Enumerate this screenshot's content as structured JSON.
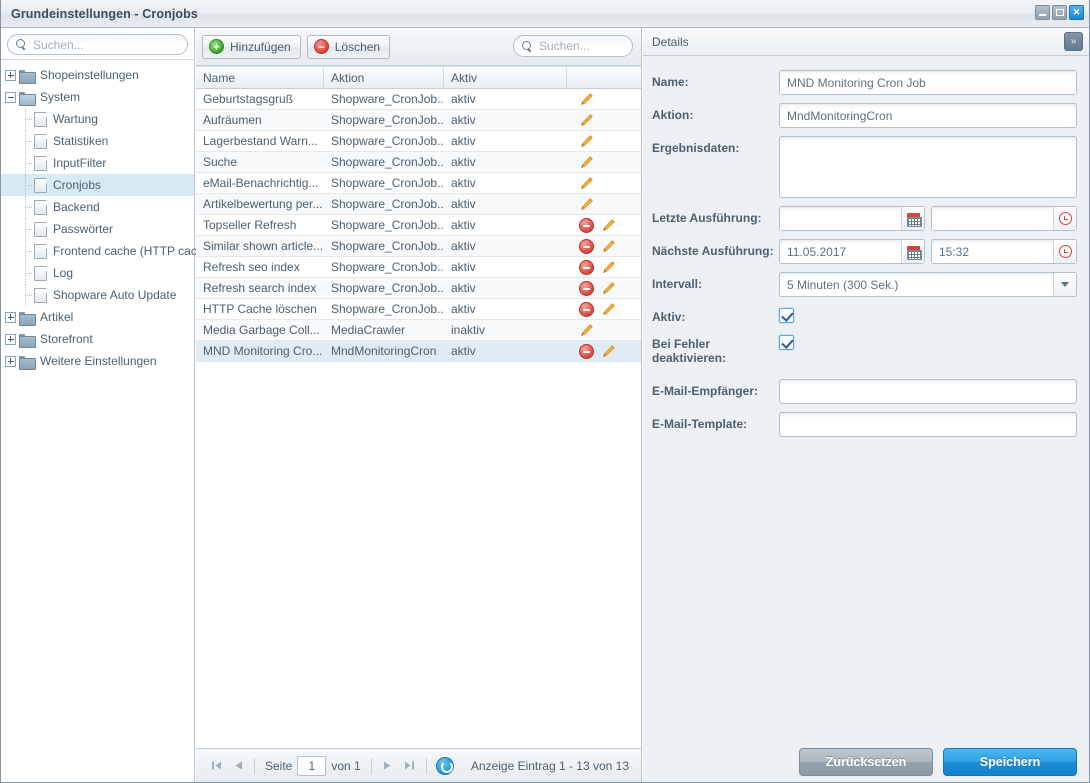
{
  "window": {
    "title": "Grundeinstellungen - Cronjobs",
    "minimize_label": "Minimieren",
    "maximize_label": "Maximieren",
    "close_label": "Schließen"
  },
  "sidebar": {
    "search_placeholder": "Suchen...",
    "search_value": "",
    "items": [
      {
        "label": "Shopeinstellungen",
        "type": "folder",
        "state": "collapsed",
        "depth": 0,
        "selected": false
      },
      {
        "label": "System",
        "type": "folder",
        "state": "expanded",
        "depth": 0,
        "selected": false
      },
      {
        "label": "Wartung",
        "type": "file",
        "state": "leaf",
        "depth": 1,
        "selected": false
      },
      {
        "label": "Statistiken",
        "type": "file",
        "state": "leaf",
        "depth": 1,
        "selected": false
      },
      {
        "label": "InputFilter",
        "type": "file",
        "state": "leaf",
        "depth": 1,
        "selected": false
      },
      {
        "label": "Cronjobs",
        "type": "file",
        "state": "leaf",
        "depth": 1,
        "selected": true
      },
      {
        "label": "Backend",
        "type": "file",
        "state": "leaf",
        "depth": 1,
        "selected": false
      },
      {
        "label": "Passwörter",
        "type": "file",
        "state": "leaf",
        "depth": 1,
        "selected": false
      },
      {
        "label": "Frontend cache (HTTP cache)",
        "type": "file",
        "state": "leaf",
        "depth": 1,
        "selected": false
      },
      {
        "label": "Log",
        "type": "file",
        "state": "leaf",
        "depth": 1,
        "selected": false
      },
      {
        "label": "Shopware Auto Update",
        "type": "file",
        "state": "leaf",
        "depth": 1,
        "selected": false
      },
      {
        "label": "Artikel",
        "type": "folder",
        "state": "collapsed",
        "depth": 0,
        "selected": false
      },
      {
        "label": "Storefront",
        "type": "folder",
        "state": "collapsed",
        "depth": 0,
        "selected": false
      },
      {
        "label": "Weitere Einstellungen",
        "type": "folder",
        "state": "collapsed",
        "depth": 0,
        "selected": false
      }
    ]
  },
  "grid": {
    "toolbar": {
      "add_label": "Hinzufügen",
      "add_icon": "plus-circle-green-icon",
      "delete_label": "Löschen",
      "delete_icon": "minus-circle-red-icon",
      "search_placeholder": "Suchen...",
      "search_value": ""
    },
    "columns": [
      "Name",
      "Aktion",
      "Aktiv",
      ""
    ],
    "rows": [
      {
        "name": "Geburtstagsgruß",
        "aktion": "Shopware_CronJob...",
        "aktiv": "aktiv",
        "has_delete": false,
        "selected": false
      },
      {
        "name": "Aufräumen",
        "aktion": "Shopware_CronJob...",
        "aktiv": "aktiv",
        "has_delete": false,
        "selected": false
      },
      {
        "name": "Lagerbestand Warn...",
        "aktion": "Shopware_CronJob...",
        "aktiv": "aktiv",
        "has_delete": false,
        "selected": false
      },
      {
        "name": "Suche",
        "aktion": "Shopware_CronJob...",
        "aktiv": "aktiv",
        "has_delete": false,
        "selected": false
      },
      {
        "name": "eMail-Benachrichtig...",
        "aktion": "Shopware_CronJob...",
        "aktiv": "aktiv",
        "has_delete": false,
        "selected": false
      },
      {
        "name": "Artikelbewertung per...",
        "aktion": "Shopware_CronJob...",
        "aktiv": "aktiv",
        "has_delete": false,
        "selected": false
      },
      {
        "name": "Topseller Refresh",
        "aktion": "Shopware_CronJob...",
        "aktiv": "aktiv",
        "has_delete": true,
        "selected": false
      },
      {
        "name": "Similar shown article...",
        "aktion": "Shopware_CronJob...",
        "aktiv": "aktiv",
        "has_delete": true,
        "selected": false
      },
      {
        "name": "Refresh seo index",
        "aktion": "Shopware_CronJob...",
        "aktiv": "aktiv",
        "has_delete": true,
        "selected": false
      },
      {
        "name": "Refresh search index",
        "aktion": "Shopware_CronJob...",
        "aktiv": "aktiv",
        "has_delete": true,
        "selected": false
      },
      {
        "name": "HTTP Cache löschen",
        "aktion": "Shopware_CronJob...",
        "aktiv": "aktiv",
        "has_delete": true,
        "selected": false
      },
      {
        "name": "Media Garbage Coll...",
        "aktion": "MediaCrawler",
        "aktiv": "inaktiv",
        "has_delete": false,
        "selected": false
      },
      {
        "name": "MND Monitoring Cro...",
        "aktion": "MndMonitoringCron",
        "aktiv": "aktiv",
        "has_delete": true,
        "selected": true
      }
    ]
  },
  "pagination": {
    "first_icon": "first-page-icon",
    "prev_icon": "previous-page-icon",
    "page_label": "Seite",
    "page_value": "1",
    "of_label": "von 1",
    "next_icon": "next-page-icon",
    "last_icon": "last-page-icon",
    "refresh_icon": "refresh-icon",
    "count_text": "Anzeige Eintrag 1 - 13 von 13"
  },
  "details": {
    "header_title": "Details",
    "collapse_icon": "chevron-double-right-icon",
    "fields": {
      "name_label": "Name:",
      "name_value": "MND Monitoring Cron Job",
      "aktion_label": "Aktion:",
      "aktion_value": "MndMonitoringCron",
      "ergebnisdaten_label": "Ergebnisdaten:",
      "ergebnisdaten_value": "",
      "letzte_label": "Letzte Ausführung:",
      "letzte_date_value": "",
      "letzte_time_value": "",
      "naechste_label": "Nächste Ausführung:",
      "naechste_date_value": "11.05.2017",
      "naechste_time_value": "15:32",
      "intervall_label": "Intervall:",
      "intervall_value": "5 Minuten (300 Sek.)",
      "aktiv_label": "Aktiv:",
      "aktiv_checked": true,
      "bei_fehler_label": "Bei Fehler deaktivieren:",
      "bei_fehler_checked": true,
      "email_empfaenger_label": "E-Mail-Empfänger:",
      "email_empfaenger_value": "",
      "email_template_label": "E-Mail-Template:",
      "email_template_value": ""
    },
    "calendar_icon": "calendar-icon",
    "clock_icon": "clock-icon",
    "dropdown_icon": "chevron-down-icon",
    "footer": {
      "reset_label": "Zurücksetzen",
      "save_label": "Speichern"
    }
  },
  "colors": {
    "accent_blue": "#1b8bd6",
    "delete_red": "#d9453d",
    "add_green": "#3ea52b",
    "pencil_orange": "#f0a830",
    "selection_blue": "#dfecf5",
    "text": "#4c6072"
  }
}
